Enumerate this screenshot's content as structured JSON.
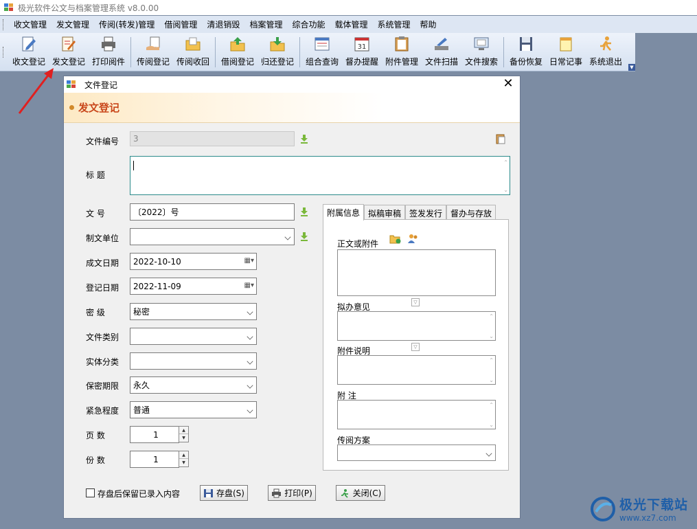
{
  "app": {
    "title": "极光软件公文与档案管理系统 v8.0.00"
  },
  "menu": [
    "收文管理",
    "发文管理",
    "传阅(转发)管理",
    "借阅管理",
    "清退销毁",
    "档案管理",
    "综合功能",
    "载体管理",
    "系统管理",
    "帮助"
  ],
  "toolbar": {
    "groups": [
      [
        {
          "label": "收文登记",
          "icon": "pencil-doc-icon"
        },
        {
          "label": "发文登记",
          "icon": "edit-doc-icon"
        },
        {
          "label": "打印阅件",
          "icon": "printer-icon"
        }
      ],
      [
        {
          "label": "传阅登记",
          "icon": "hand-doc-icon"
        },
        {
          "label": "传阅收回",
          "icon": "folder-open-icon"
        }
      ],
      [
        {
          "label": "借阅登记",
          "icon": "folder-up-icon"
        },
        {
          "label": "归还登记",
          "icon": "folder-down-icon"
        }
      ],
      [
        {
          "label": "组合查询",
          "icon": "window-query-icon"
        },
        {
          "label": "督办提醒",
          "icon": "calendar-icon"
        },
        {
          "label": "附件管理",
          "icon": "clipboard-icon"
        },
        {
          "label": "文件扫描",
          "icon": "scanner-icon"
        },
        {
          "label": "文件搜索",
          "icon": "monitor-search-icon"
        }
      ],
      [
        {
          "label": "备份恢复",
          "icon": "floppy-icon"
        },
        {
          "label": "日常记事",
          "icon": "notepad-icon"
        },
        {
          "label": "系统退出",
          "icon": "running-man-icon"
        }
      ]
    ]
  },
  "dialog": {
    "title": "文件登记",
    "header": "发文登记",
    "close": "✕",
    "fields": {
      "file_no": {
        "label": "文件编号",
        "value": "3"
      },
      "subject": {
        "label": "标  题",
        "value": ""
      },
      "doc_no": {
        "label": "文  号",
        "value": "〔2022〕号"
      },
      "issuer": {
        "label": "制文单位",
        "value": ""
      },
      "created_date": {
        "label": "成文日期",
        "value": "2022-10-10"
      },
      "register_date": {
        "label": "登记日期",
        "value": "2022-11-09"
      },
      "secrecy": {
        "label": "密  级",
        "value": "秘密"
      },
      "category": {
        "label": "文件类别",
        "value": ""
      },
      "entity_class": {
        "label": "实体分类",
        "value": ""
      },
      "retention": {
        "label": "保密期限",
        "value": "永久"
      },
      "urgency": {
        "label": "紧急程度",
        "value": "普通"
      },
      "pages": {
        "label": "页  数",
        "value": "1"
      },
      "copies": {
        "label": "份  数",
        "value": "1"
      }
    },
    "tabs": [
      "附属信息",
      "拟稿审稿",
      "签发发行",
      "督办与存放"
    ],
    "tab_panel": {
      "attachment_label": "正文或附件",
      "opinion_label": "拟办意见",
      "attach_note_label": "附件说明",
      "note_label": "附  注",
      "circulation_label": "传阅方案"
    },
    "keep_checkbox": "存盘后保留已录入内容",
    "buttons": {
      "save": "存盘(S)",
      "print": "打印(P)",
      "close": "关闭(C)"
    }
  },
  "watermark": {
    "title": "极光下载站",
    "url": "www.xz7.com"
  }
}
